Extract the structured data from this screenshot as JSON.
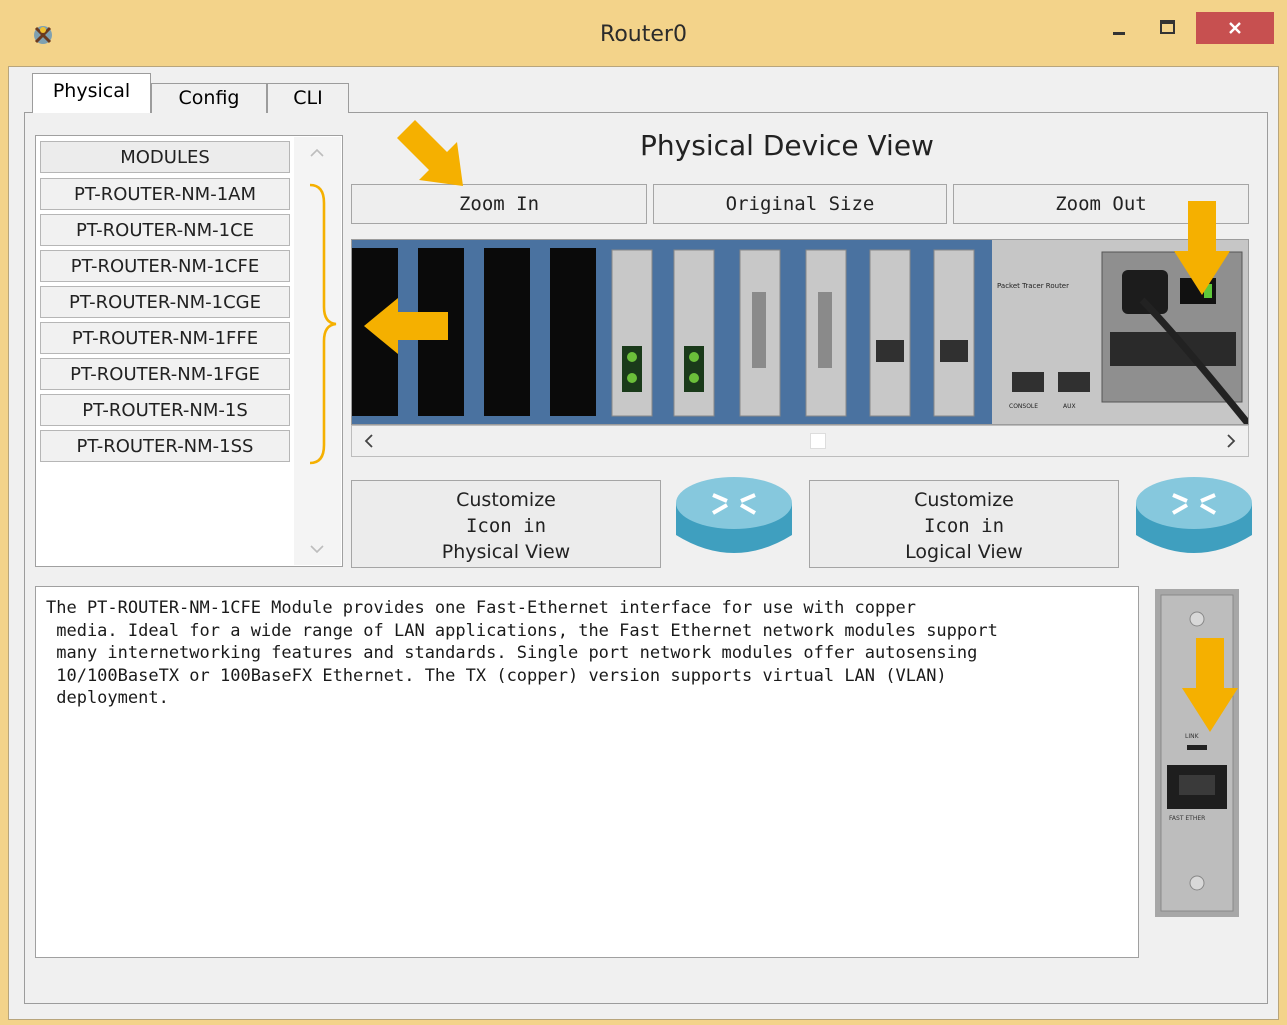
{
  "window": {
    "title": "Router0",
    "colors": {
      "frame": "#f3d38a",
      "close": "#c75050",
      "arrow": "#f5b000"
    }
  },
  "tabs": [
    {
      "label": "Physical",
      "active": true
    },
    {
      "label": "Config",
      "active": false
    },
    {
      "label": "CLI",
      "active": false
    }
  ],
  "modules": {
    "header": "MODULES",
    "items": [
      "PT-ROUTER-NM-1AM",
      "PT-ROUTER-NM-1CE",
      "PT-ROUTER-NM-1CFE",
      "PT-ROUTER-NM-1CGE",
      "PT-ROUTER-NM-1FFE",
      "PT-ROUTER-NM-1FGE",
      "PT-ROUTER-NM-1S",
      "PT-ROUTER-NM-1SS"
    ]
  },
  "physical_view": {
    "title": "Physical Device View",
    "zoom_in": "Zoom In",
    "original_size": "Original Size",
    "zoom_out": "Zoom Out",
    "chassis_label": "Packet Tracer Router",
    "console_label": "CONSOLE",
    "aux_label": "AUX"
  },
  "customize": {
    "physical": [
      "Customize",
      "Icon in",
      "Physical View"
    ],
    "logical": [
      "Customize",
      "Icon in",
      "Logical View"
    ]
  },
  "description": {
    "lines": [
      "The PT-ROUTER-NM-1CFE Module provides one Fast-Ethernet interface for use with copper",
      " media. Ideal for a wide range of LAN applications, the Fast Ethernet network modules support",
      " many internetworking features and standards. Single port network modules offer autosensing",
      " 10/100BaseTX or 100BaseFX Ethernet. The TX (copper) version supports virtual LAN (VLAN)",
      " deployment."
    ]
  },
  "module_preview": {
    "link_label": "LINK",
    "port_label": "FAST ETHER"
  }
}
